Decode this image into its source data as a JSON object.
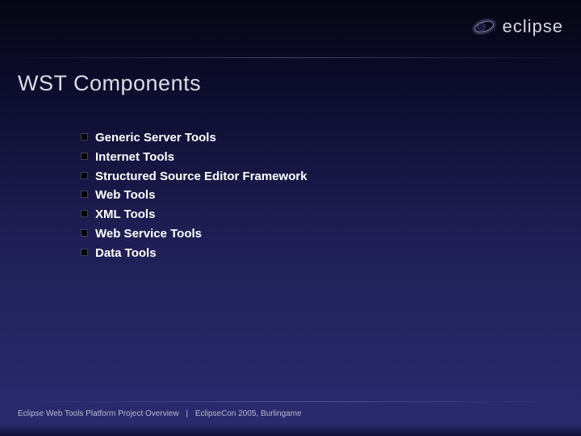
{
  "header": {
    "logo_text": "eclipse"
  },
  "slide": {
    "title": "WST Components",
    "bullets": [
      "Generic Server Tools",
      "Internet Tools",
      "Structured Source Editor Framework",
      "Web Tools",
      "XML Tools",
      "Web Service Tools",
      "Data Tools"
    ]
  },
  "footer": {
    "left": "Eclipse Web Tools Platform Project Overview",
    "separator": "|",
    "right": "EclipseCon 2005, Burlingame"
  }
}
